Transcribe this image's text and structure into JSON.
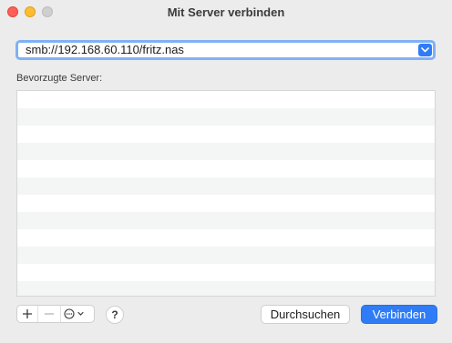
{
  "window": {
    "title": "Mit Server verbinden"
  },
  "address_field": {
    "value": "smb://192.168.60.110/fritz.nas"
  },
  "favorites": {
    "label": "Bevorzugte Server:",
    "items": []
  },
  "toolbar": {
    "add_icon": "plus-icon",
    "remove_icon": "minus-icon",
    "more_icon": "ellipsis-circle-icon",
    "help_label": "?"
  },
  "buttons": {
    "browse_label": "Durchsuchen",
    "connect_label": "Verbinden"
  },
  "colors": {
    "accent": "#2f7cf6",
    "focus_ring": "#7fb1f4",
    "close": "#ff5f57",
    "minimize": "#febc2e",
    "zoom_disabled": "#cfcfcf"
  }
}
